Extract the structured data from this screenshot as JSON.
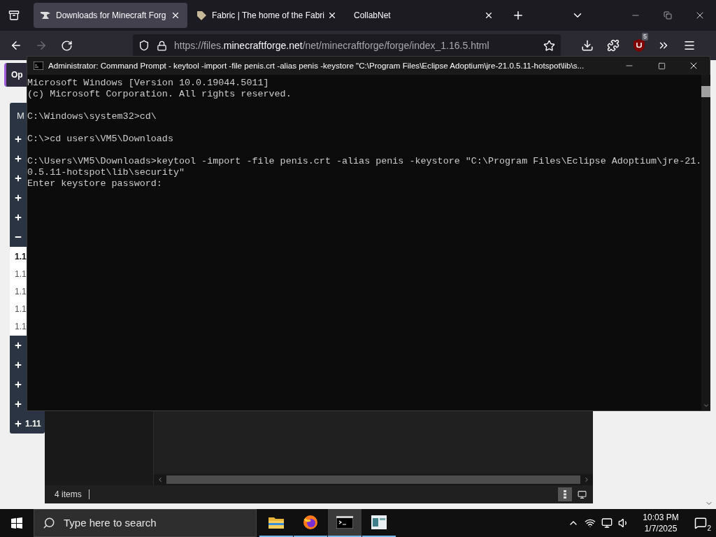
{
  "browser": {
    "tabs": [
      {
        "label": "Downloads for Minecraft Forg",
        "selected": true,
        "kind": "forge"
      },
      {
        "label": "Fabric | The home of the Fabri",
        "selected": false,
        "kind": "fabric"
      },
      {
        "label": "CollabNet",
        "selected": false,
        "kind": "plain"
      }
    ],
    "nav": {
      "back_disabled": false,
      "forward_disabled": true
    },
    "url": {
      "scheme": "https://files.",
      "domain": "minecraftforge.net",
      "path": "/net/minecraftforge/forge/index_1.16.5.html"
    },
    "extension_badge": "5"
  },
  "page": {
    "open_button": "Op",
    "sidebar_header": "M",
    "sidebar_items": [
      {
        "expanded": false
      },
      {
        "expanded": false
      },
      {
        "expanded": false
      },
      {
        "expanded": false
      },
      {
        "expanded": false
      },
      {
        "expanded": true,
        "children": [
          {
            "label": "1.1",
            "current": true
          },
          {
            "label": "1.1",
            "current": false
          },
          {
            "label": "1.1",
            "current": false
          },
          {
            "label": "1.1",
            "current": false
          },
          {
            "label": "1.1",
            "current": false
          }
        ]
      },
      {
        "expanded": false
      },
      {
        "expanded": false
      },
      {
        "expanded": false
      },
      {
        "expanded": false
      },
      {
        "expanded": false,
        "label": "1.11"
      }
    ]
  },
  "command_prompt": {
    "title": "Administrator: Command Prompt - keytool  -import -file penis.crt -alias penis -keystore \"C:\\Program Files\\Eclipse Adoptium\\jre-21.0.5.11-hotspot\\lib\\s...",
    "blocks": [
      [
        "Microsoft Windows [Version 10.0.19044.5011]",
        "(c) Microsoft Corporation. All rights reserved."
      ],
      [
        "C:\\Windows\\system32>cd\\"
      ],
      [
        "C:\\>cd users\\VM5\\Downloads"
      ],
      [
        "C:\\Users\\VM5\\Downloads>keytool -import -file penis.crt -alias penis -keystore \"C:\\Program Files\\Eclipse Adoptium\\jre-21.",
        "0.5.11-hotspot\\lib\\security\"",
        "Enter keystore password:"
      ]
    ]
  },
  "explorer": {
    "status": "4 items"
  },
  "taskbar": {
    "search_placeholder": "Type here to search",
    "apps": [
      {
        "kind": "folder",
        "selected": false
      },
      {
        "kind": "firefox",
        "selected": false
      },
      {
        "kind": "terminal",
        "selected": true
      },
      {
        "kind": "window",
        "selected": false
      }
    ],
    "time": "10:03 PM",
    "date": "1/7/2025",
    "notifications": "2"
  }
}
